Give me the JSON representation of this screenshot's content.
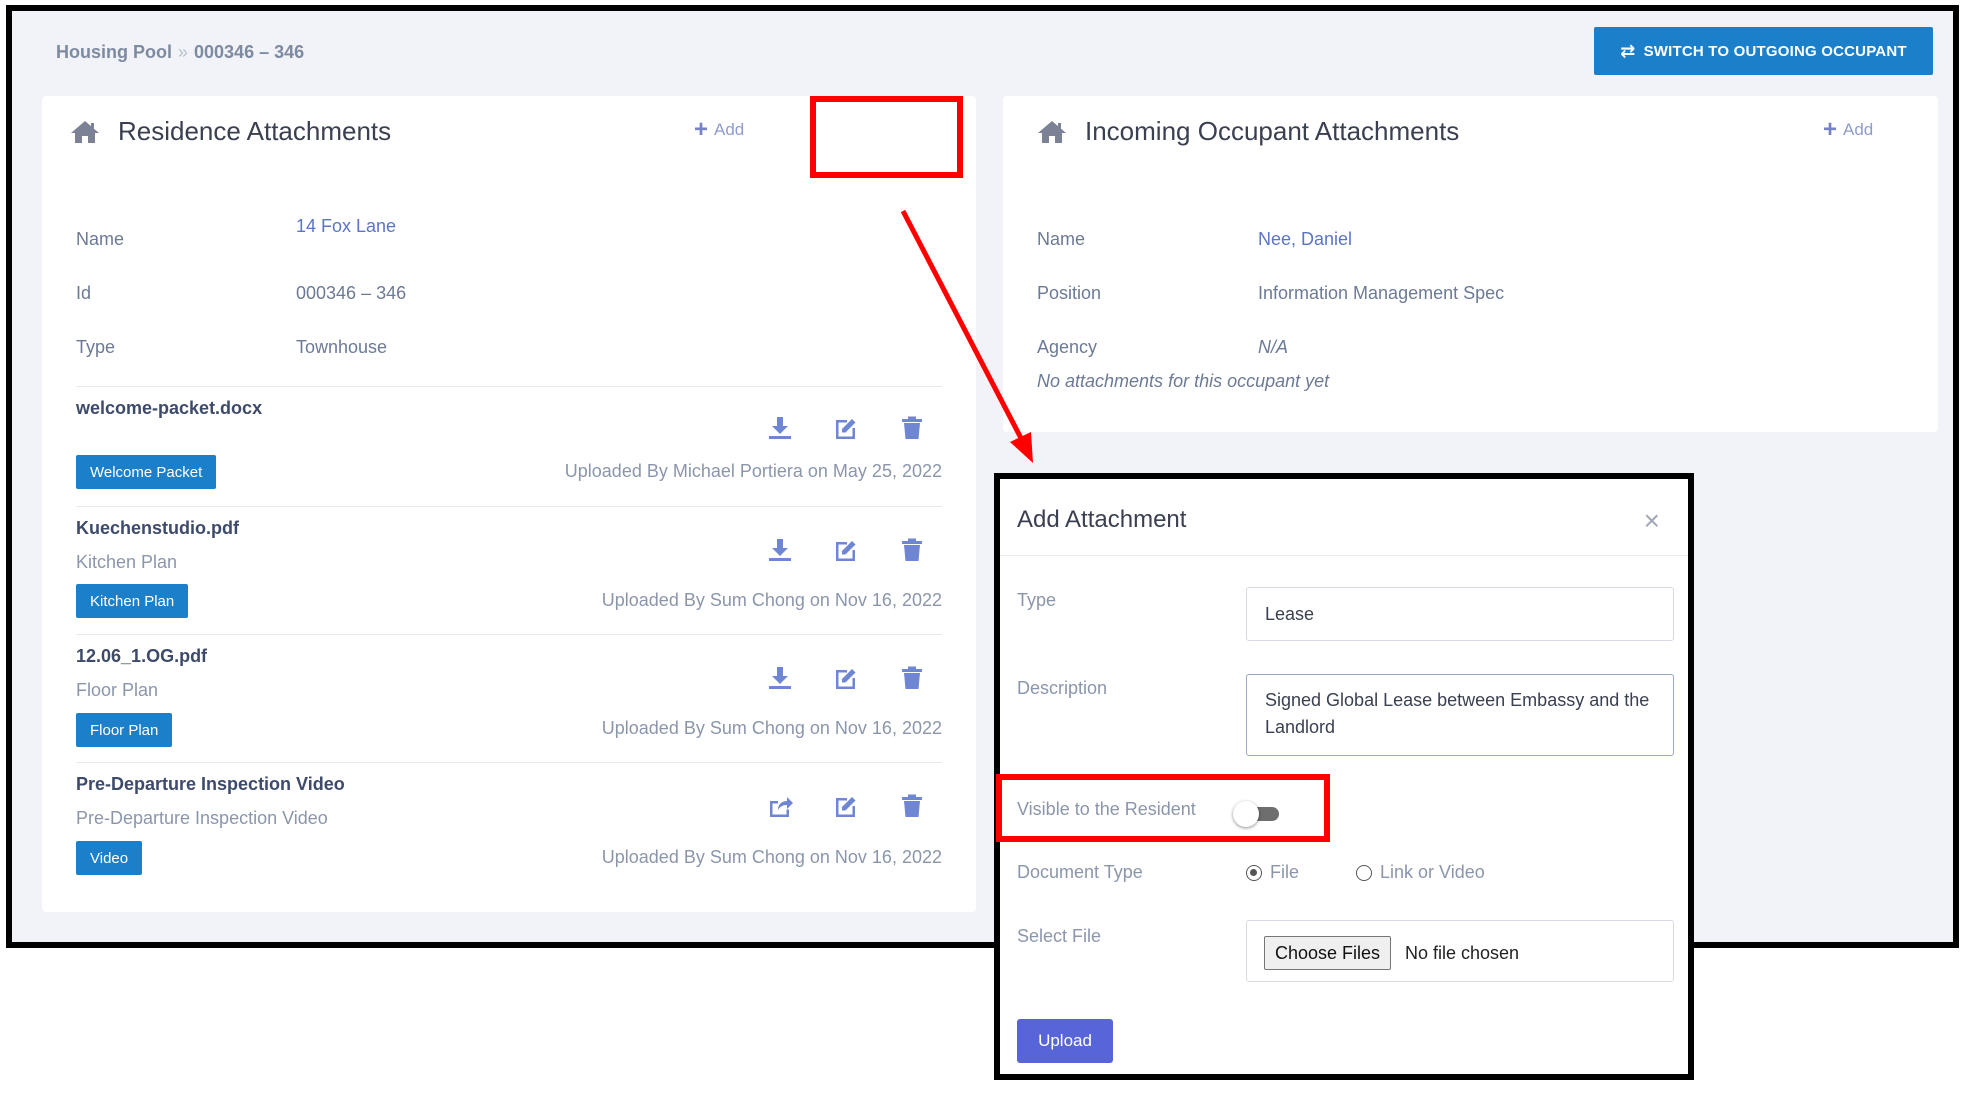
{
  "breadcrumb": {
    "root": "Housing Pool",
    "separator": "»",
    "current": "000346 – 346"
  },
  "switch_button": {
    "label": "SWITCH TO OUTGOING OCCUPANT",
    "icon": "swap-icon"
  },
  "residence": {
    "title": "Residence Attachments",
    "add_label": "Add",
    "name_label": "Name",
    "name_value": "14 Fox Lane",
    "id_label": "Id",
    "id_value": "000346 – 346",
    "type_label": "Type",
    "type_value": "Townhouse",
    "attachments": [
      {
        "file": "welcome-packet.docx",
        "description": "",
        "tag": "Welcome Packet",
        "uploaded": "Uploaded By Michael Portiera on May 25, 2022",
        "first_icon": "download-icon"
      },
      {
        "file": "Kuechenstudio.pdf",
        "description": "Kitchen Plan",
        "tag": "Kitchen Plan",
        "uploaded": "Uploaded By Sum Chong on Nov 16, 2022",
        "first_icon": "download-icon"
      },
      {
        "file": "12.06_1.OG.pdf",
        "description": "Floor Plan",
        "tag": "Floor Plan",
        "uploaded": "Uploaded By Sum Chong on Nov 16, 2022",
        "first_icon": "download-icon"
      },
      {
        "file": "Pre-Departure Inspection Video",
        "description": "Pre-Departure Inspection Video",
        "tag": "Video",
        "uploaded": "Uploaded By Sum Chong on Nov 16, 2022",
        "first_icon": "share-icon"
      }
    ]
  },
  "occupant": {
    "title": "Incoming Occupant Attachments",
    "add_label": "Add",
    "name_label": "Name",
    "name_value": "Nee, Daniel",
    "position_label": "Position",
    "position_value": "Information Management Spec",
    "agency_label": "Agency",
    "agency_value": "N/A",
    "empty_message": "No attachments for this occupant yet"
  },
  "modal": {
    "title": "Add Attachment",
    "close_label": "×",
    "type_label": "Type",
    "type_value": "Lease",
    "description_label": "Description",
    "description_value": "Signed Global Lease between Embassy and the Landlord",
    "visible_label": "Visible to the Resident",
    "visible_on": false,
    "document_type_label": "Document Type",
    "document_type_options": [
      "File",
      "Link or Video"
    ],
    "document_type_selected": "File",
    "select_file_label": "Select File",
    "choose_files_label": "Choose Files",
    "no_file_label": "No file chosen",
    "upload_label": "Upload"
  },
  "colors": {
    "primary": "#1c7fc9",
    "upload_button": "#5865d9",
    "annotation_red": "#ff0000",
    "link": "#5a75c6",
    "page_bg": "#f2f3f8"
  }
}
